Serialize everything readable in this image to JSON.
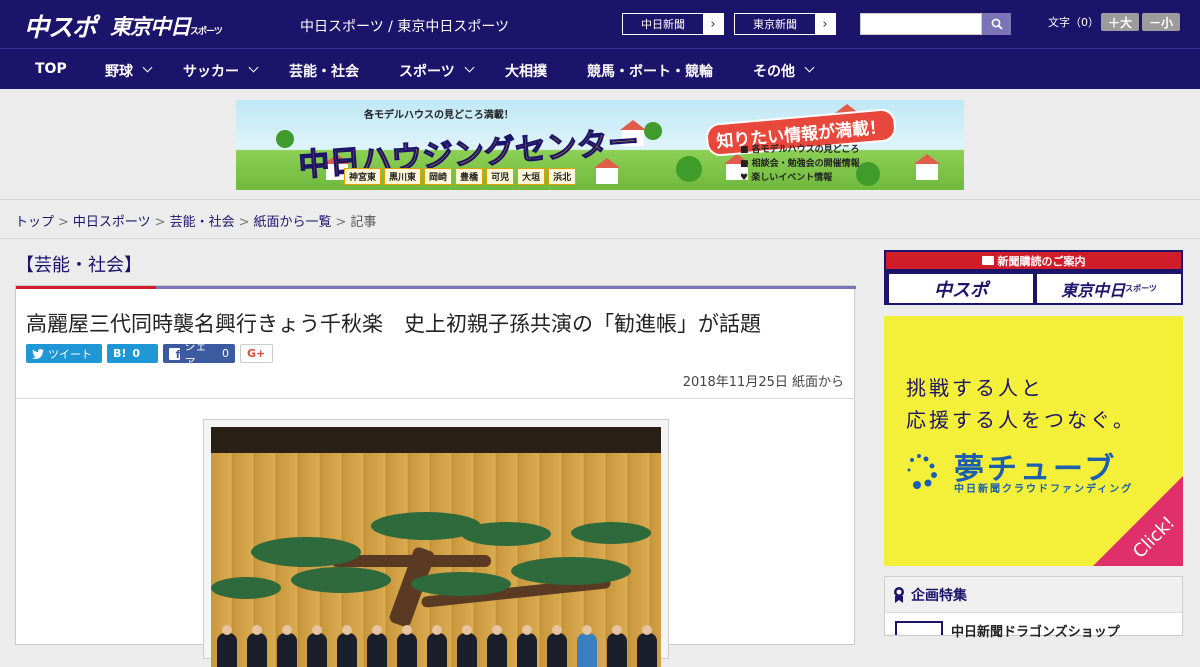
{
  "header": {
    "logo_chuspo": "中スポ",
    "logo_tokyo": "東京中日",
    "logo_tokyo_small": "スポーツ",
    "site_title": "中日スポーツ / 東京中日スポーツ",
    "paper_links": [
      "中日新聞",
      "東京新聞"
    ],
    "search": {
      "placeholder": ""
    },
    "fontsize_label": "文字（0）",
    "fontsize_larger": "＋大",
    "fontsize_smaller": "－小"
  },
  "nav": {
    "items": [
      "TOP",
      "野球",
      "サッカー",
      "芸能・社会",
      "スポーツ",
      "大相撲",
      "競馬・ボート・競輪",
      "その他"
    ]
  },
  "banner": {
    "subtitle": "各モデルハウスの見どころ満載！",
    "title": "中日ハウジングセンター",
    "ribbon": "知りたい情報が満載！",
    "info": [
      "各モデルハウスの見どころ",
      "相談会・勉強会の開催情報",
      "楽しいイベント情報"
    ],
    "towns": [
      "神宮東",
      "黒川東",
      "岡崎",
      "豊橋",
      "可児",
      "大垣",
      "浜北"
    ]
  },
  "breadcrumb": {
    "items": [
      "トップ",
      "中日スポーツ",
      "芸能・社会",
      "紙面から一覧"
    ],
    "current": "記事"
  },
  "article": {
    "category": "【芸能・社会】",
    "headline": "高麗屋三代同時襲名興行きょう千秋楽　史上初親子孫共演の「勧進帳」が話題",
    "share": {
      "tweet": "ツイート",
      "hatena_icon": "B!",
      "hatena_count": "0",
      "facebook_label": "シェア",
      "facebook_count": "0",
      "gplus": "G+"
    },
    "pubdate": "2018年11月25日 紙面から"
  },
  "sidebar": {
    "subscription_head": "新聞購読のご案内",
    "subscription_chuspo": "中スポ",
    "subscription_tokyo": "東京中日",
    "subscription_tokyo_small": "スポーツ",
    "yume_lines": [
      "挑戦する人と",
      "応援する人をつなぐ。"
    ],
    "yume_logo": "夢チューブ",
    "yume_sub": "中日新聞クラウドファンディング",
    "yume_click": "Click!",
    "kikaku_head": "企画特集",
    "kikaku_item": "中日新聞ドラゴンズショップ"
  }
}
